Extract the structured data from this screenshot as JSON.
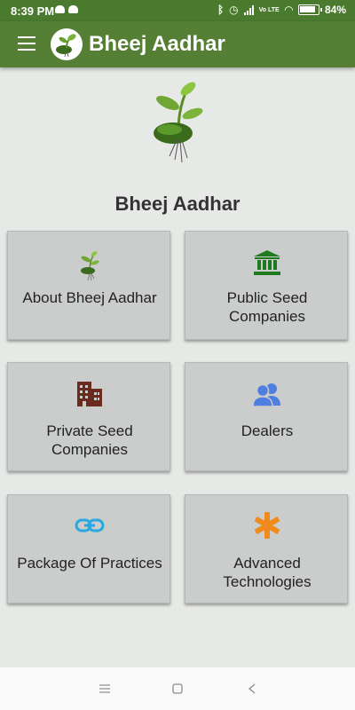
{
  "status_bar": {
    "time": "8:39 PM",
    "network_label": "Vo LTE",
    "battery_percent": "84%"
  },
  "app_bar": {
    "title": "Bheej Aadhar",
    "menu_icon": "hamburger-menu-icon",
    "logo_icon": "seedling-logo"
  },
  "hero": {
    "title": "Bheej Aadhar"
  },
  "cards": [
    {
      "label": "About Bheej Aadhar",
      "icon": "seedling-icon",
      "color": "#5b8a2e"
    },
    {
      "label": "Public Seed Companies",
      "icon": "bank-building-icon",
      "color": "#1f7a1f"
    },
    {
      "label": "Private Seed Companies",
      "icon": "office-building-icon",
      "color": "#6b2a1e"
    },
    {
      "label": "Dealers",
      "icon": "people-icon",
      "color": "#4f7fe0"
    },
    {
      "label": "Package Of Practices",
      "icon": "link-icon",
      "color": "#2aa8e0"
    },
    {
      "label": "Advanced Technologies",
      "icon": "asterisk-icon",
      "color": "#f08a1c"
    }
  ],
  "nav_bar": {
    "recents_icon": "recents-icon",
    "home_icon": "home-icon",
    "back_icon": "back-icon"
  }
}
